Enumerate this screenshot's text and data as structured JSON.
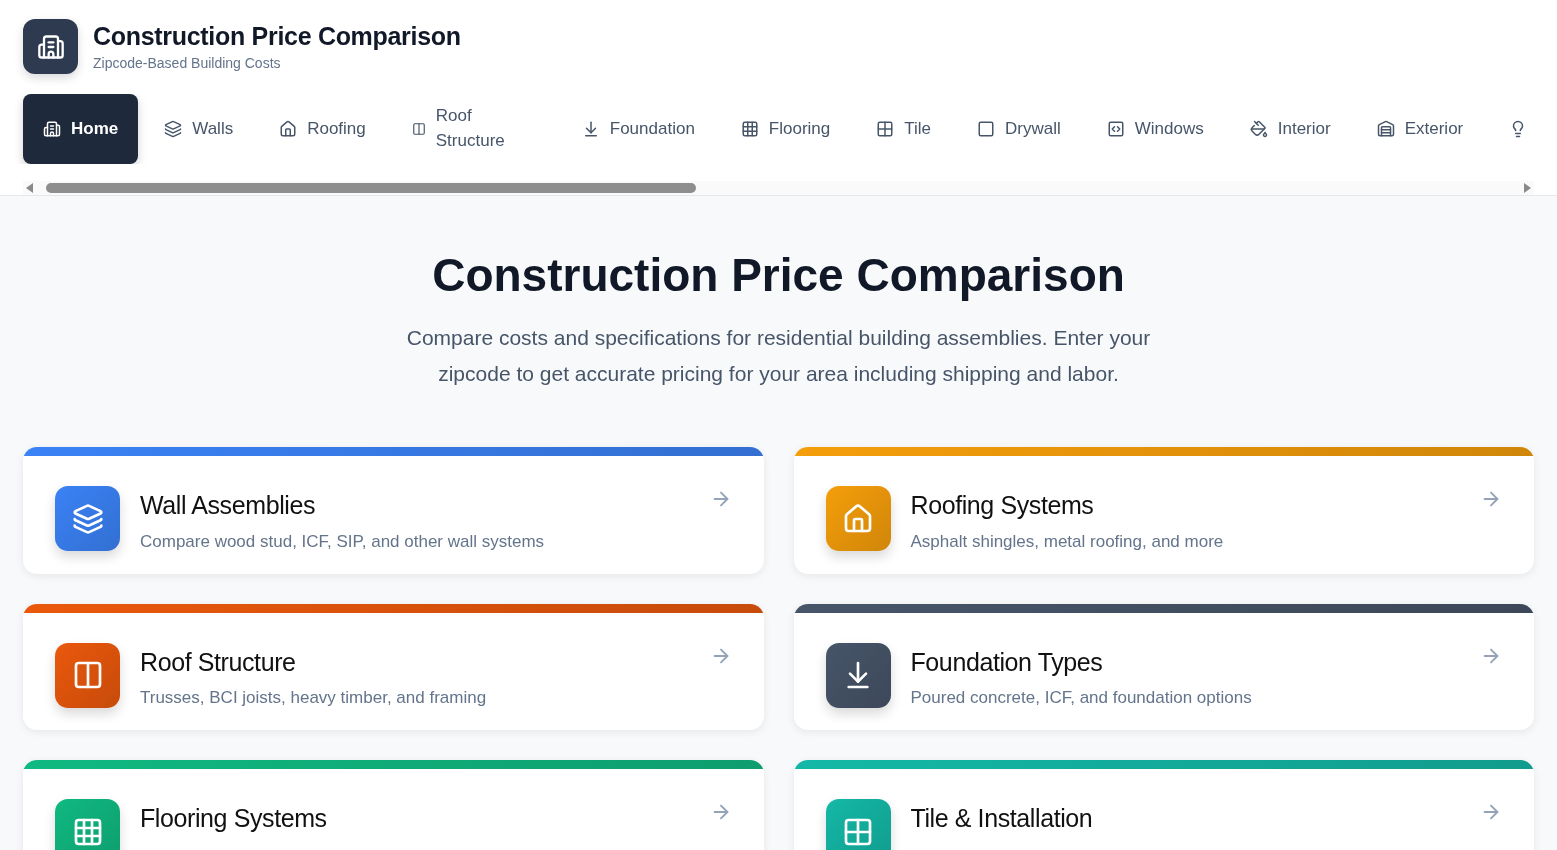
{
  "header": {
    "title": "Construction Price Comparison",
    "subtitle": "Zipcode-Based Building Costs"
  },
  "tabs": [
    {
      "label": "Home",
      "selected": true
    },
    {
      "label": "Walls",
      "selected": false
    },
    {
      "label": "Roofing",
      "selected": false
    },
    {
      "label": "Roof Structure",
      "selected": false
    },
    {
      "label": "Foundation",
      "selected": false
    },
    {
      "label": "Flooring",
      "selected": false
    },
    {
      "label": "Tile",
      "selected": false
    },
    {
      "label": "Drywall",
      "selected": false
    },
    {
      "label": "Windows",
      "selected": false
    },
    {
      "label": "Interior",
      "selected": false
    },
    {
      "label": "Exterior",
      "selected": false
    }
  ],
  "hero": {
    "title": "Construction Price Comparison",
    "description": "Compare costs and specifications for residential building assemblies. Enter your zipcode to get accurate pricing for your area including shipping and labor."
  },
  "cards": [
    {
      "title": "Wall Assemblies",
      "description": "Compare wood stud, ICF, SIP, and other wall systems",
      "color": "#3b82f6"
    },
    {
      "title": "Roofing Systems",
      "description": "Asphalt shingles, metal roofing, and more",
      "color": "#f59e0b"
    },
    {
      "title": "Roof Structure",
      "description": "Trusses, BCI joists, heavy timber, and framing",
      "color": "#ea580c"
    },
    {
      "title": "Foundation Types",
      "description": "Poured concrete, ICF, and foundation options",
      "color": "#475569"
    },
    {
      "title": "Flooring Systems",
      "color": "#10b981"
    },
    {
      "title": "Tile & Installation",
      "color": "#14b8a6"
    }
  ]
}
